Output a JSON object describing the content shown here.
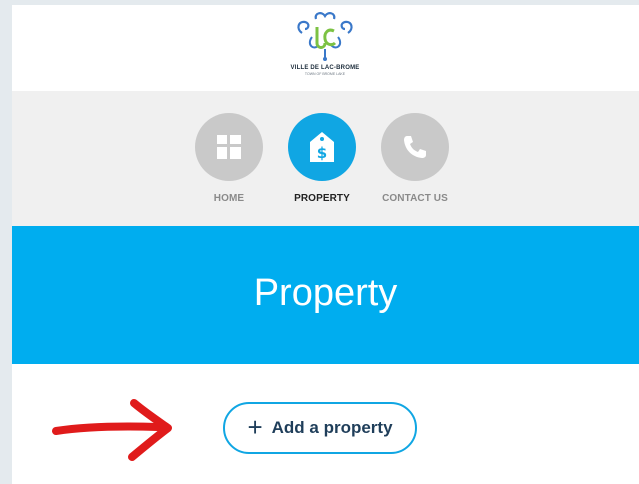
{
  "header": {
    "logo_title": "VILLE DE LAC-BROME",
    "logo_subtitle": "TOWN OF BROME LAKE"
  },
  "nav": {
    "items": [
      {
        "label": "HOME",
        "icon": "home-icon",
        "active": false
      },
      {
        "label": "PROPERTY",
        "icon": "property-tag-icon",
        "active": true
      },
      {
        "label": "CONTACT US",
        "icon": "phone-icon",
        "active": false
      }
    ]
  },
  "banner": {
    "title": "Property"
  },
  "content": {
    "add_button_icon": "+",
    "add_button_label": "Add a property"
  },
  "colors": {
    "accent": "#00adef",
    "nav_active": "#10a6e3",
    "nav_inactive": "#c9c9c9",
    "button_text": "#1f3e5a",
    "annotation_arrow": "#e01b1b"
  }
}
